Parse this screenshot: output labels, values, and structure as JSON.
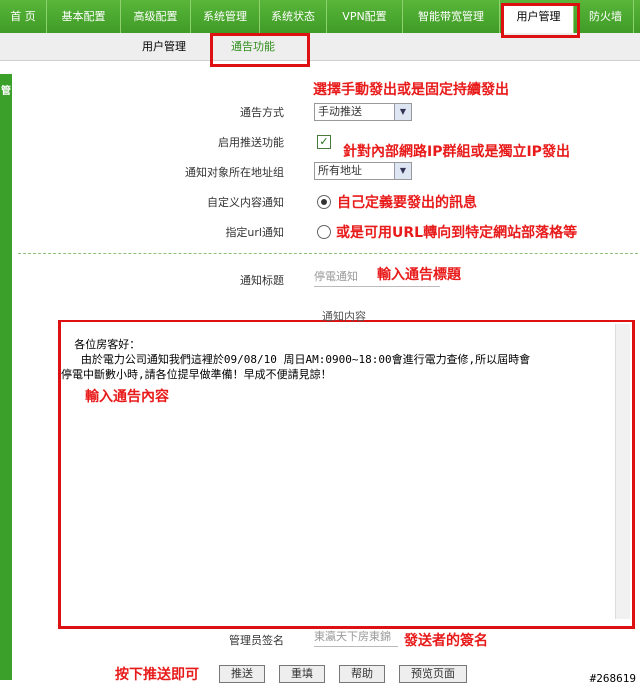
{
  "topnav": {
    "tabs": [
      "首 页",
      "基本配置",
      "高级配置",
      "系统管理",
      "系统状态",
      "VPN配置",
      "智能带宽管理",
      "用户管理",
      "防火墙"
    ],
    "active": "用户管理"
  },
  "subnav": {
    "items": [
      "用户管理",
      "通告功能"
    ],
    "active": "通告功能"
  },
  "leftbar": {
    "glyph": "管"
  },
  "form": {
    "notify_mode_label": "通告方式",
    "notify_mode_value": "手动推送",
    "enable_push_label": "启用推送功能",
    "enable_push_checked": true,
    "target_group_label": "通知对象所在地址组",
    "target_group_value": "所有地址",
    "custom_content_label": "自定义内容通知",
    "custom_content_selected": true,
    "url_label": "指定url通知",
    "url_selected": false,
    "title_label": "通知标题",
    "title_value": "停電通知",
    "content_label": "通知内容",
    "content_value": "各位房客好：\n   由於電力公司通知我們這裡於09/08/10 周日AM:0900~18:00會進行電力查修,所以屆時會\n停電中斷數小時,請各位提早做準備！早成不便請見諒！",
    "signature_label": "管理员签名",
    "signature_value": "東瀛天下房東錦"
  },
  "buttons": {
    "push": "推送",
    "reset": "重填",
    "help": "帮助",
    "preview": "预览页面"
  },
  "annotations": {
    "a1": "選擇手動發出或是固定持續發出",
    "a2": "針對內部網路IP群組或是獨立IP發出",
    "a3": "自己定義要發出的訊息",
    "a4": "或是可用URL轉向到特定網站部落格等",
    "a5": "輸入通告標題",
    "a6": "輸入通告內容",
    "a7": "發送者的簽名",
    "a8": "按下推送即可"
  },
  "watermark": "#268619",
  "colors": {
    "nav_green": "#4aa82f",
    "annotation_red": "#e81a1a"
  }
}
